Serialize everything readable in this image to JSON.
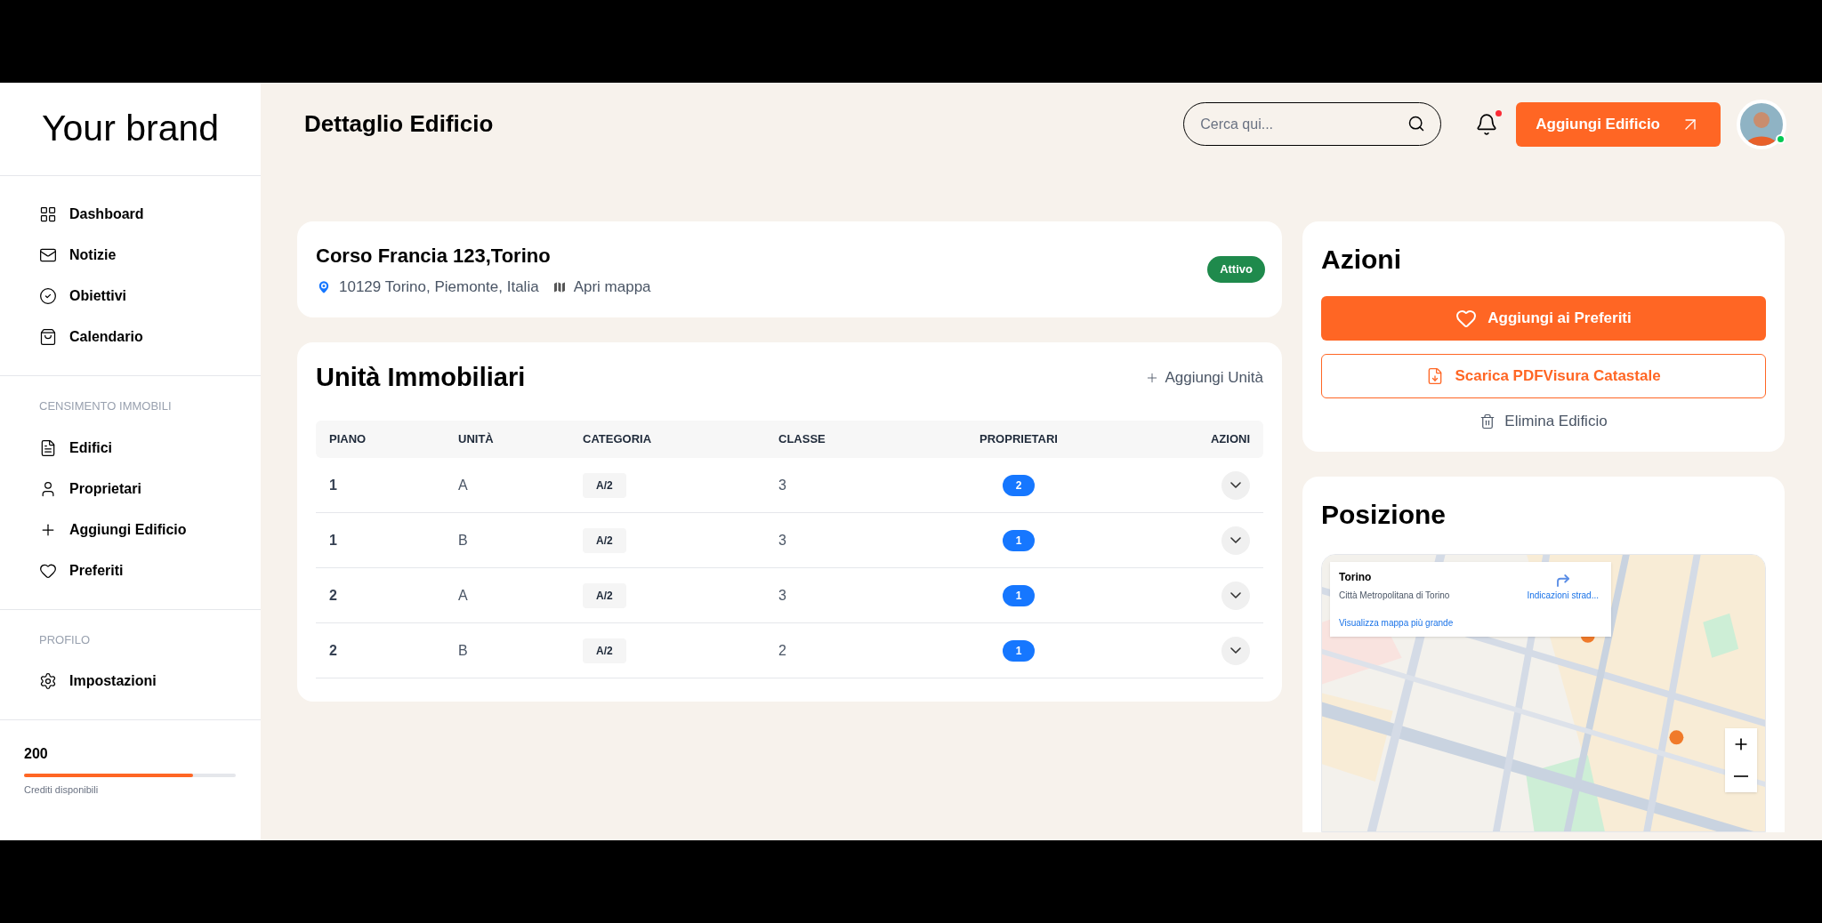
{
  "sidebar": {
    "brand": "Your brand",
    "sections": [
      {
        "items": [
          {
            "label": "Dashboard"
          },
          {
            "label": "Notizie"
          },
          {
            "label": "Obiettivi"
          },
          {
            "label": "Calendario"
          }
        ]
      },
      {
        "title": "CENSIMENTO IMMOBILI",
        "items": [
          {
            "label": "Edifici"
          },
          {
            "label": "Proprietari"
          },
          {
            "label": "Aggiungi Edificio"
          },
          {
            "label": "Preferiti"
          }
        ]
      },
      {
        "title": "PROFILO",
        "items": [
          {
            "label": "Impostazioni"
          }
        ]
      }
    ],
    "credits": {
      "value": "200",
      "level": 0.8,
      "label": "Crediti disponibili"
    }
  },
  "header": {
    "title": "Dettaglio Edificio",
    "search": {
      "placeholder": "Cerca qui..."
    },
    "notification_unread": true,
    "add_button": "Aggiungi Edificio",
    "avatar_online": true
  },
  "building": {
    "address": "Corso Francia 123,Torino",
    "location": "10129 Torino, Piemonte, Italia",
    "map_link": "Apri mappa",
    "status": "Attivo"
  },
  "units": {
    "title": "Unità Immobiliari",
    "add_link": "Aggiungi Unità",
    "columns": [
      "PIANO",
      "UNITÀ",
      "CATEGORIA",
      "CLASSE",
      "PROPRIETARI",
      "AZIONI"
    ],
    "rows": [
      {
        "piano": "1",
        "unita": "A",
        "categoria": "A/2",
        "classe": "3",
        "proprietari": "2"
      },
      {
        "piano": "1",
        "unita": "B",
        "categoria": "A/2",
        "classe": "3",
        "proprietari": "1"
      },
      {
        "piano": "2",
        "unita": "A",
        "categoria": "A/2",
        "classe": "3",
        "proprietari": "1"
      },
      {
        "piano": "2",
        "unita": "B",
        "categoria": "A/2",
        "classe": "2",
        "proprietari": "1"
      }
    ]
  },
  "actions": {
    "title": "Azioni",
    "favorite": "Aggiungi ai Preferiti",
    "download": "Scarica PDFVisura Catastale",
    "delete": "Elimina Edificio"
  },
  "position": {
    "title": "Posizione",
    "map": {
      "kind": "picture",
      "place": "Torino",
      "region": "Città Metropolitana di Torino",
      "directions": "Indicazioni strad...",
      "larger_map": "Visualizza mappa più grande"
    }
  }
}
